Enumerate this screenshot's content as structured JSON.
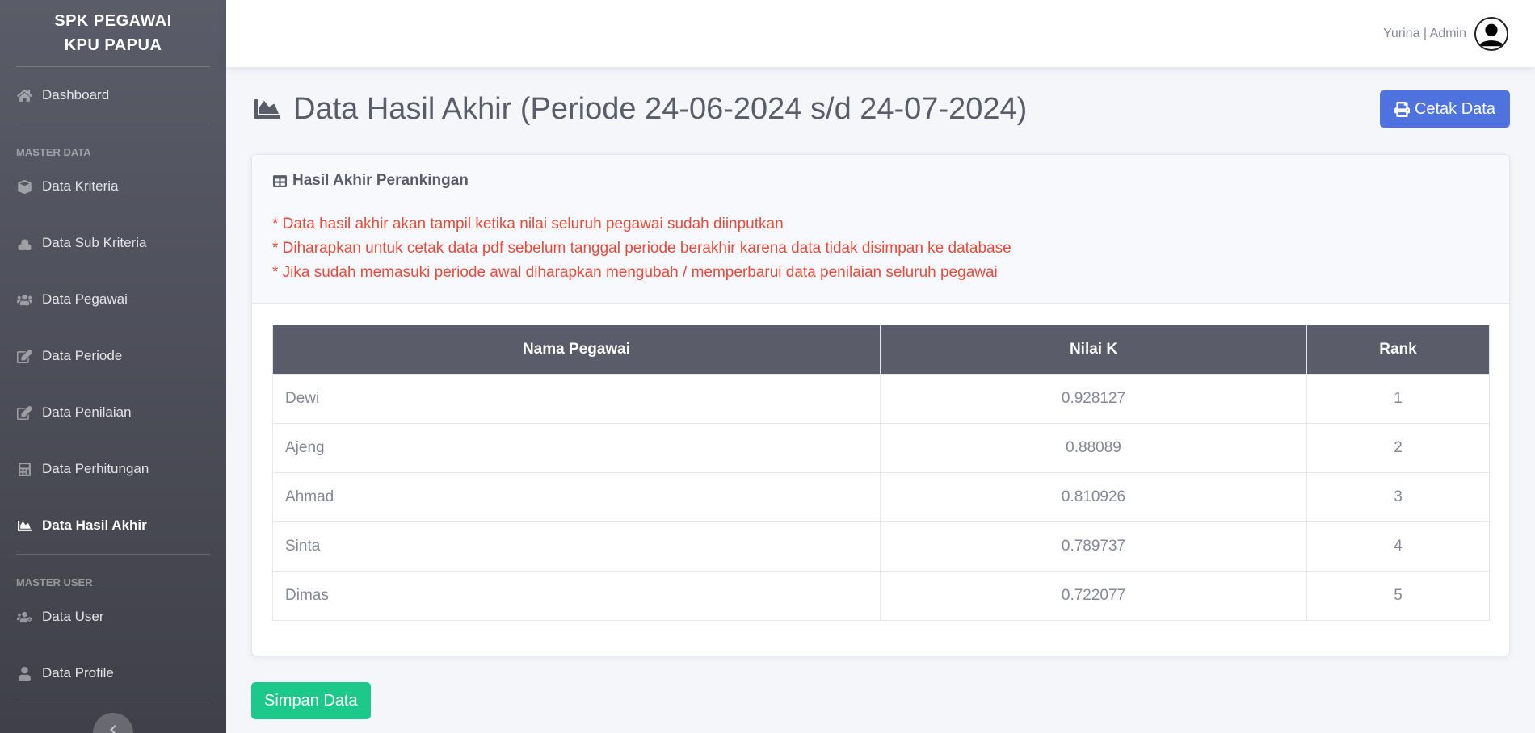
{
  "sidebar": {
    "brand_line1": "SPK PEGAWAI",
    "brand_line2": "KPU PAPUA",
    "dashboard": "Dashboard",
    "section_master_data": "MASTER DATA",
    "items": [
      {
        "label": "Data Kriteria",
        "icon": "cube-icon"
      },
      {
        "label": "Data Sub Kriteria",
        "icon": "cubes-icon"
      },
      {
        "label": "Data Pegawai",
        "icon": "users-icon"
      },
      {
        "label": "Data Periode",
        "icon": "edit-icon"
      },
      {
        "label": "Data Penilaian",
        "icon": "edit-icon"
      },
      {
        "label": "Data Perhitungan",
        "icon": "calculator-icon"
      },
      {
        "label": "Data Hasil Akhir",
        "icon": "chart-area-icon",
        "active": true
      }
    ],
    "section_master_user": "MASTER USER",
    "user_items": [
      {
        "label": "Data User",
        "icon": "users-cog-icon"
      },
      {
        "label": "Data Profile",
        "icon": "user-icon"
      }
    ]
  },
  "topbar": {
    "user_label": "Yurina | Admin"
  },
  "page": {
    "title": "Data Hasil Akhir (Periode 24-06-2024 s/d 24-07-2024)",
    "print_button": "Cetak Data",
    "save_button": "Simpan Data"
  },
  "card": {
    "title": "Hasil Akhir Perankingan",
    "notes": [
      "* Data hasil akhir akan tampil ketika nilai seluruh pegawai sudah diinputkan",
      "* Diharapkan untuk cetak data pdf sebelum tanggal periode berakhir karena data tidak disimpan ke database",
      "* Jika sudah memasuki periode awal diharapkan mengubah / memperbarui data penilaian seluruh pegawai"
    ]
  },
  "table": {
    "headers": [
      "Nama Pegawai",
      "Nilai K",
      "Rank"
    ],
    "rows": [
      [
        "Dewi",
        "0.928127",
        "1"
      ],
      [
        "Ajeng",
        "0.88089",
        "2"
      ],
      [
        "Ahmad",
        "0.810926",
        "3"
      ],
      [
        "Sinta",
        "0.789737",
        "4"
      ],
      [
        "Dimas",
        "0.722077",
        "5"
      ]
    ]
  },
  "colors": {
    "sidebar_top": "#5a5c69",
    "primary": "#4e73df",
    "success": "#1cc88a",
    "danger": "#e74a3b"
  }
}
